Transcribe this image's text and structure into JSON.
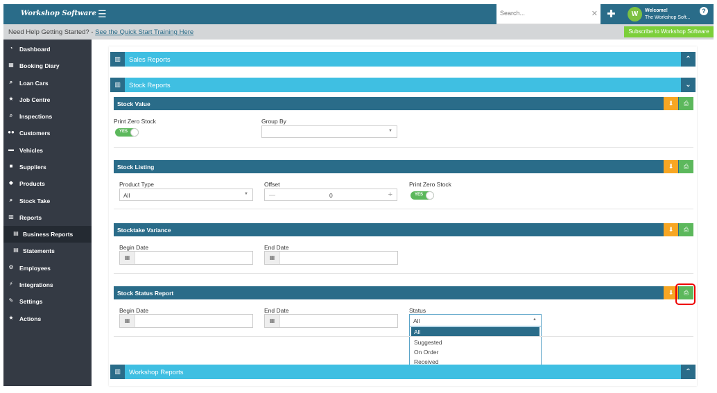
{
  "header": {
    "logo": "Workshop Software",
    "menu_icon": "hamburger-icon",
    "search_placeholder": "Search...",
    "add_icon": "plus-icon",
    "welcome": "Welcome!",
    "user": "The Workshop Soft...",
    "help": "?"
  },
  "helpbar": {
    "prefix": "Need Help Getting Started? - ",
    "link": "See the Quick Start Training Here",
    "subscribe": "Subscribe to Workshop Software"
  },
  "sidebar": {
    "items": [
      {
        "label": "Dashboard",
        "icon": "dashboard-icon"
      },
      {
        "label": "Booking Diary",
        "icon": "calendar-icon"
      },
      {
        "label": "Loan Cars",
        "icon": "search-icon"
      },
      {
        "label": "Job Centre",
        "icon": "star-icon"
      },
      {
        "label": "Inspections",
        "icon": "search-icon"
      },
      {
        "label": "Customers",
        "icon": "users-icon"
      },
      {
        "label": "Vehicles",
        "icon": "car-icon"
      },
      {
        "label": "Suppliers",
        "icon": "truck-icon"
      },
      {
        "label": "Products",
        "icon": "tag-icon"
      },
      {
        "label": "Stock Take",
        "icon": "search-icon"
      },
      {
        "label": "Reports",
        "icon": "chart-icon"
      },
      {
        "label": "Business Reports",
        "icon": "document-icon"
      },
      {
        "label": "Statements",
        "icon": "document-icon"
      },
      {
        "label": "Employees",
        "icon": "cogs-icon"
      },
      {
        "label": "Integrations",
        "icon": "plug-icon"
      },
      {
        "label": "Settings",
        "icon": "wrench-icon"
      },
      {
        "label": "Actions",
        "icon": "star-icon"
      }
    ]
  },
  "panels": {
    "sales": "Sales Reports",
    "stock": "Stock Reports",
    "workshop": "Workshop Reports"
  },
  "stock_value": {
    "title": "Stock Value",
    "print_zero_label": "Print Zero Stock",
    "print_zero_value": "YES",
    "group_by_label": "Group By",
    "group_by_value": ""
  },
  "stock_listing": {
    "title": "Stock Listing",
    "product_type_label": "Product Type",
    "product_type_value": "All",
    "offset_label": "Offset",
    "offset_value": "0",
    "print_zero_label": "Print Zero Stock",
    "print_zero_value": "YES"
  },
  "stocktake_variance": {
    "title": "Stocktake Variance",
    "begin_label": "Begin Date",
    "end_label": "End Date"
  },
  "stock_status": {
    "title": "Stock Status Report",
    "begin_label": "Begin Date",
    "end_label": "End Date",
    "status_label": "Status",
    "status_value": "All",
    "status_options": [
      "All",
      "Suggested",
      "On Order",
      "Received"
    ]
  },
  "colors": {
    "topbar": "#2a6c89",
    "accent": "#3fbfe2",
    "download": "#f7a623",
    "print": "#5cb85c",
    "sidebar": "#343a44"
  }
}
